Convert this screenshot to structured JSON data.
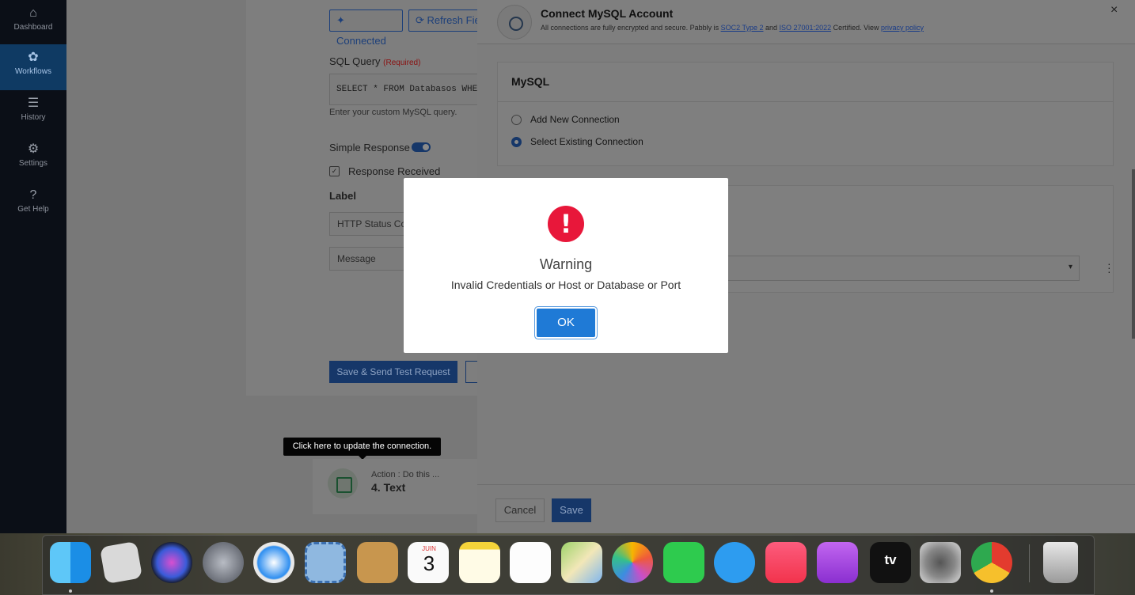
{
  "sidebar": {
    "items": [
      {
        "label": "Dashboard",
        "icon": "home-icon"
      },
      {
        "label": "Workflows",
        "icon": "workflow-icon"
      },
      {
        "label": "History",
        "icon": "list-icon"
      },
      {
        "label": "Settings",
        "icon": "gear-icon"
      },
      {
        "label": "Get Help",
        "icon": "question-icon"
      }
    ]
  },
  "form": {
    "connected_label": "✦ Connected",
    "refresh_label": "⟳ Refresh Fiel",
    "sql_label": "SQL Query",
    "required_label": "(Required)",
    "sql_value": "SELECT * FROM Databasos WHE",
    "sql_hint": "Enter your custom MySQL query.",
    "simple_response_label": "Simple Response",
    "response_received_label": "Response Received",
    "label_heading": "Label",
    "http_status_value": "HTTP Status Co",
    "message_value": "Message",
    "save_send_label": "Save & Send Test Request"
  },
  "tooltip": "Click here to update the connection.",
  "action": {
    "subtitle": "Action : Do this ...",
    "title": "4. Text"
  },
  "panel": {
    "title": "Connect MySQL Account",
    "subtitle_prefix": "All connections are fully encrypted and secure. Pabbly is ",
    "soc2": "SOC2 Type 2",
    "and": " and ",
    "iso": "ISO 27001:2022",
    "certified": " Certified. View ",
    "privacy": "privacy policy",
    "close": "×",
    "section_title": "MySQL",
    "radio_new": "Add New Connection",
    "radio_existing": "Select Existing Connection",
    "selected_option": "existing",
    "cancel_label": "Cancel",
    "save_label": "Save"
  },
  "modal": {
    "icon": "!",
    "title": "Warning",
    "message": "Invalid Credentials or Host or Database or Port",
    "ok_label": "OK"
  },
  "dock": {
    "calendar_month": "JUIN",
    "calendar_day": "3",
    "tv_label": "tv",
    "apps": [
      "finder",
      "roblox",
      "siri",
      "launchpad",
      "safari",
      "mail",
      "contacts",
      "calendar",
      "notes",
      "reminders",
      "maps",
      "photos",
      "facetime",
      "messages",
      "music",
      "podcasts",
      "apple-tv",
      "system-preferences",
      "chrome",
      "trash"
    ]
  }
}
